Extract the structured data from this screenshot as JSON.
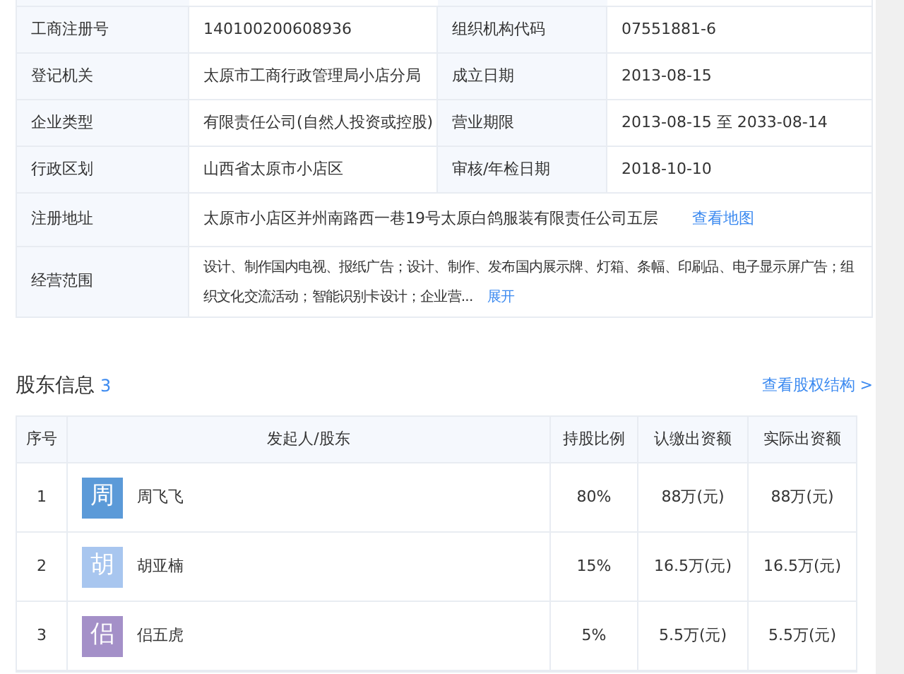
{
  "info_rows": [
    {
      "cells": [
        {
          "label": "工商注册号",
          "value": "140100200608936"
        },
        {
          "label": "组织机构代码",
          "value": "07551881-6"
        }
      ]
    },
    {
      "cells": [
        {
          "label": "登记机关",
          "value": "太原市工商行政管理局小店分局"
        },
        {
          "label": "成立日期",
          "value": "2013-08-15"
        }
      ]
    },
    {
      "cells": [
        {
          "label": "企业类型",
          "value": "有限责任公司(自然人投资或控股)"
        },
        {
          "label": "营业期限",
          "value": "2013-08-15 至 2033-08-14"
        }
      ]
    },
    {
      "cells": [
        {
          "label": "行政区划",
          "value": "山西省太原市小店区"
        },
        {
          "label": "审核/年检日期",
          "value": "2018-10-10"
        }
      ]
    }
  ],
  "address": {
    "label": "注册地址",
    "value": "太原市小店区并州南路西一巷19号太原白鸽服装有限责任公司五层",
    "link": "查看地图"
  },
  "scope": {
    "label": "经营范围",
    "value": "设计、制作国内电视、报纸广告；设计、制作、发布国内展示牌、灯箱、条幅、印刷品、电子显示屏广告；组织文化交流活动；智能识别卡设计；企业营...",
    "link": "展开"
  },
  "shareholders": {
    "title": "股东信息",
    "count": "3",
    "link": "查看股权结构 >",
    "columns": [
      "序号",
      "发起人/股东",
      "持股比例",
      "认缴出资额",
      "实际出资额"
    ],
    "rows": [
      {
        "index": "1",
        "avatar": "周",
        "color": "#5b9ad8",
        "name": "周飞飞",
        "ratio": "80%",
        "subscribed": "88万(元)",
        "paid": "88万(元)"
      },
      {
        "index": "2",
        "avatar": "胡",
        "color": "#a8c6ef",
        "name": "胡亚楠",
        "ratio": "15%",
        "subscribed": "16.5万(元)",
        "paid": "16.5万(元)"
      },
      {
        "index": "3",
        "avatar": "侣",
        "color": "#a490c8",
        "name": "侣五虎",
        "ratio": "5%",
        "subscribed": "5.5万(元)",
        "paid": "5.5万(元)"
      }
    ]
  }
}
